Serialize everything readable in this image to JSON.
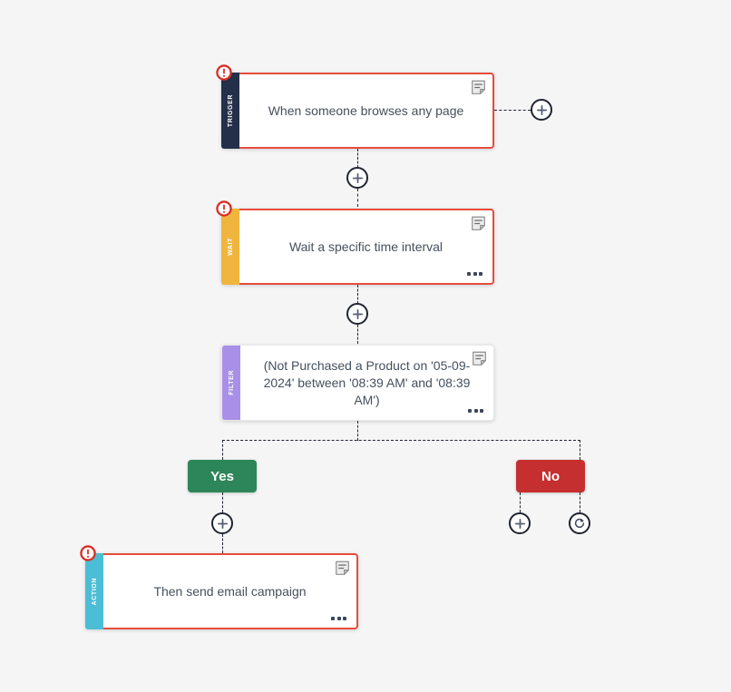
{
  "canvas": {
    "background": "#f5f5f5"
  },
  "colors": {
    "trigger_tag": "#24304a",
    "wait_tag": "#f0b53f",
    "filter_tag": "#a98fe8",
    "action_tag": "#4bbdd4",
    "error_border": "#e74c3c",
    "yes": "#2d8659",
    "no": "#c62f2f",
    "connector": "#1f2430",
    "node_text": "#45505e"
  },
  "nodes": [
    {
      "id": "trigger",
      "tag": "TRIGGER",
      "title": "When someone browses any page",
      "has_error": true,
      "has_note_icon": true,
      "has_menu": false
    },
    {
      "id": "wait",
      "tag": "WAIT",
      "title": "Wait a specific time interval",
      "has_error": true,
      "has_note_icon": true,
      "has_menu": true
    },
    {
      "id": "filter",
      "tag": "FILTER",
      "title": "(Not Purchased a Product on '05-09-2024' between '08:39 AM' and '08:39 AM')",
      "has_error": false,
      "has_note_icon": true,
      "has_menu": true
    },
    {
      "id": "action",
      "tag": "ACTION",
      "title": "Then send email campaign",
      "has_error": true,
      "has_note_icon": true,
      "has_menu": true
    }
  ],
  "branches": {
    "yes_label": "Yes",
    "no_label": "No"
  },
  "icons": {
    "warning": "warning-icon",
    "note": "note-icon",
    "menu": "ellipsis-menu-icon",
    "add": "plus-icon",
    "restart": "refresh-icon"
  },
  "connectors": {
    "add_trigger_side": "add-step-button",
    "add_after_trigger": "add-step-button",
    "add_after_wait": "add-step-button",
    "add_yes_branch": "add-step-button",
    "add_no_branch": "add-step-button",
    "restart_no_branch": "restart-flow-button"
  }
}
